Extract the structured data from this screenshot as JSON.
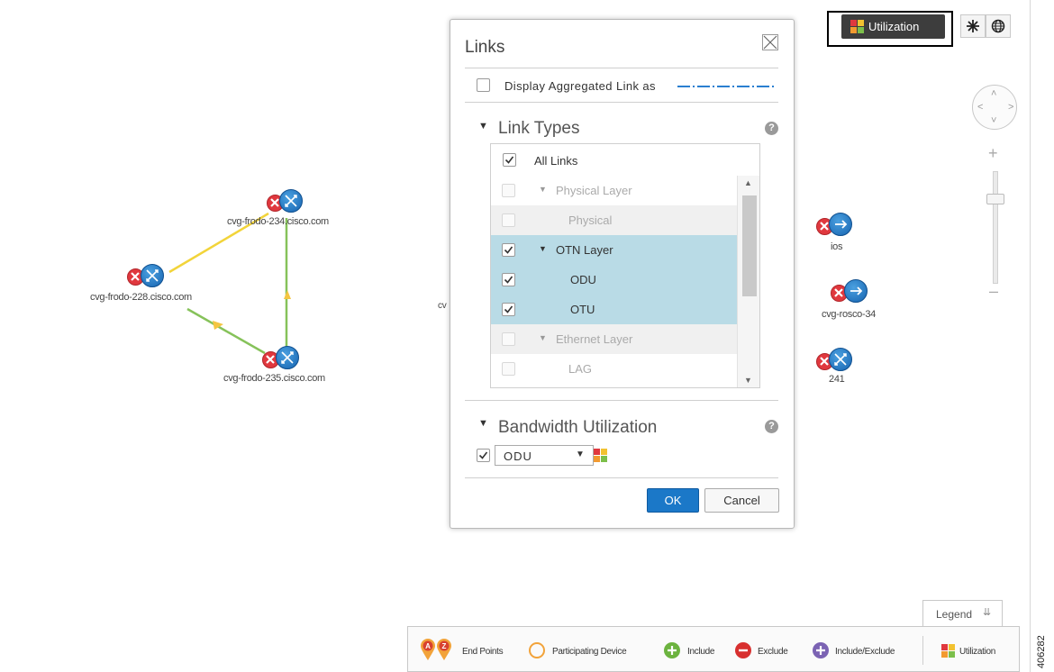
{
  "toolbar": {
    "utilization_label": "Utilization",
    "layout_icon": "topology-layout-icon",
    "map_icon": "globe-icon"
  },
  "topology": {
    "nodes": [
      {
        "label": "cvg-frodo-234.cisco.com"
      },
      {
        "label": "cvg-frodo-228.cisco.com"
      },
      {
        "label": "cvg-frodo-235.cisco.com"
      },
      {
        "label": "cv"
      },
      {
        "label": "ios"
      },
      {
        "label": "cvg-rosco-34"
      },
      {
        "label": "241"
      }
    ],
    "colors": {
      "link_yellow": "#f2d43a",
      "link_green": "#86c25a",
      "arrow_yellow": "#f4c542",
      "router_blue": "#1f77c4",
      "exclude_red": "#e0383e"
    }
  },
  "links_dialog": {
    "title": "Links",
    "aggregated_label": "Display Aggregated Link as",
    "aggregated_checked": false,
    "link_types": {
      "heading": "Link Types",
      "all_links": {
        "label": "All Links",
        "checked": true
      },
      "rows": [
        {
          "label": "Physical Layer",
          "checked": false,
          "enabled": false,
          "group": true,
          "selected": false
        },
        {
          "label": "Physical",
          "checked": false,
          "enabled": false,
          "group": false,
          "selected": false
        },
        {
          "label": "OTN Layer",
          "checked": true,
          "enabled": true,
          "group": true,
          "selected": true
        },
        {
          "label": "ODU",
          "checked": true,
          "enabled": true,
          "group": false,
          "selected": true
        },
        {
          "label": "OTU",
          "checked": true,
          "enabled": true,
          "group": false,
          "selected": true
        },
        {
          "label": "Ethernet Layer",
          "checked": false,
          "enabled": false,
          "group": true,
          "selected": false
        },
        {
          "label": "LAG",
          "checked": false,
          "enabled": false,
          "group": false,
          "selected": false
        }
      ]
    },
    "bandwidth": {
      "heading": "Bandwidth Utilization",
      "checked": true,
      "selected_option": "ODU"
    },
    "ok_label": "OK",
    "cancel_label": "Cancel"
  },
  "legend": {
    "tab_label": "Legend",
    "items": [
      {
        "label": "End Points",
        "icon": "endpoint-az-icon"
      },
      {
        "label": "Participating Device",
        "icon": "participating-ring-icon"
      },
      {
        "label": "Include",
        "icon": "include-icon"
      },
      {
        "label": "Exclude",
        "icon": "exclude-icon"
      },
      {
        "label": "Include/Exclude",
        "icon": "include-exclude-icon"
      },
      {
        "label": "Utilization",
        "icon": "utilization-icon"
      }
    ],
    "endpoint_letters": [
      "A",
      "Z"
    ]
  },
  "figure_id": "406282"
}
